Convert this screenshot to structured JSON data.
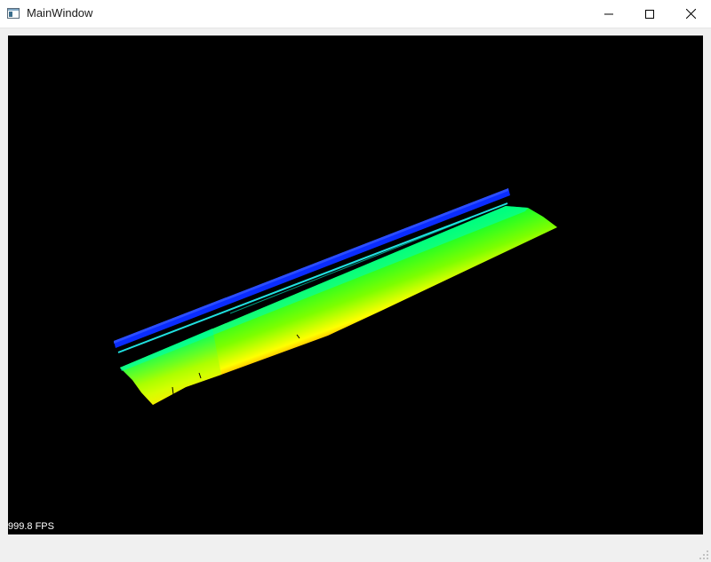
{
  "window": {
    "title": "MainWindow"
  },
  "controls": {
    "minimize_icon": "minimize-icon",
    "maximize_icon": "maximize-icon",
    "close_icon": "close-icon"
  },
  "viewer": {
    "background": "#000000",
    "fps_text": "999.8 FPS",
    "colormap": [
      "#0000ff",
      "#00ffff",
      "#00ff00",
      "#ffff00",
      "#ff0000"
    ]
  }
}
